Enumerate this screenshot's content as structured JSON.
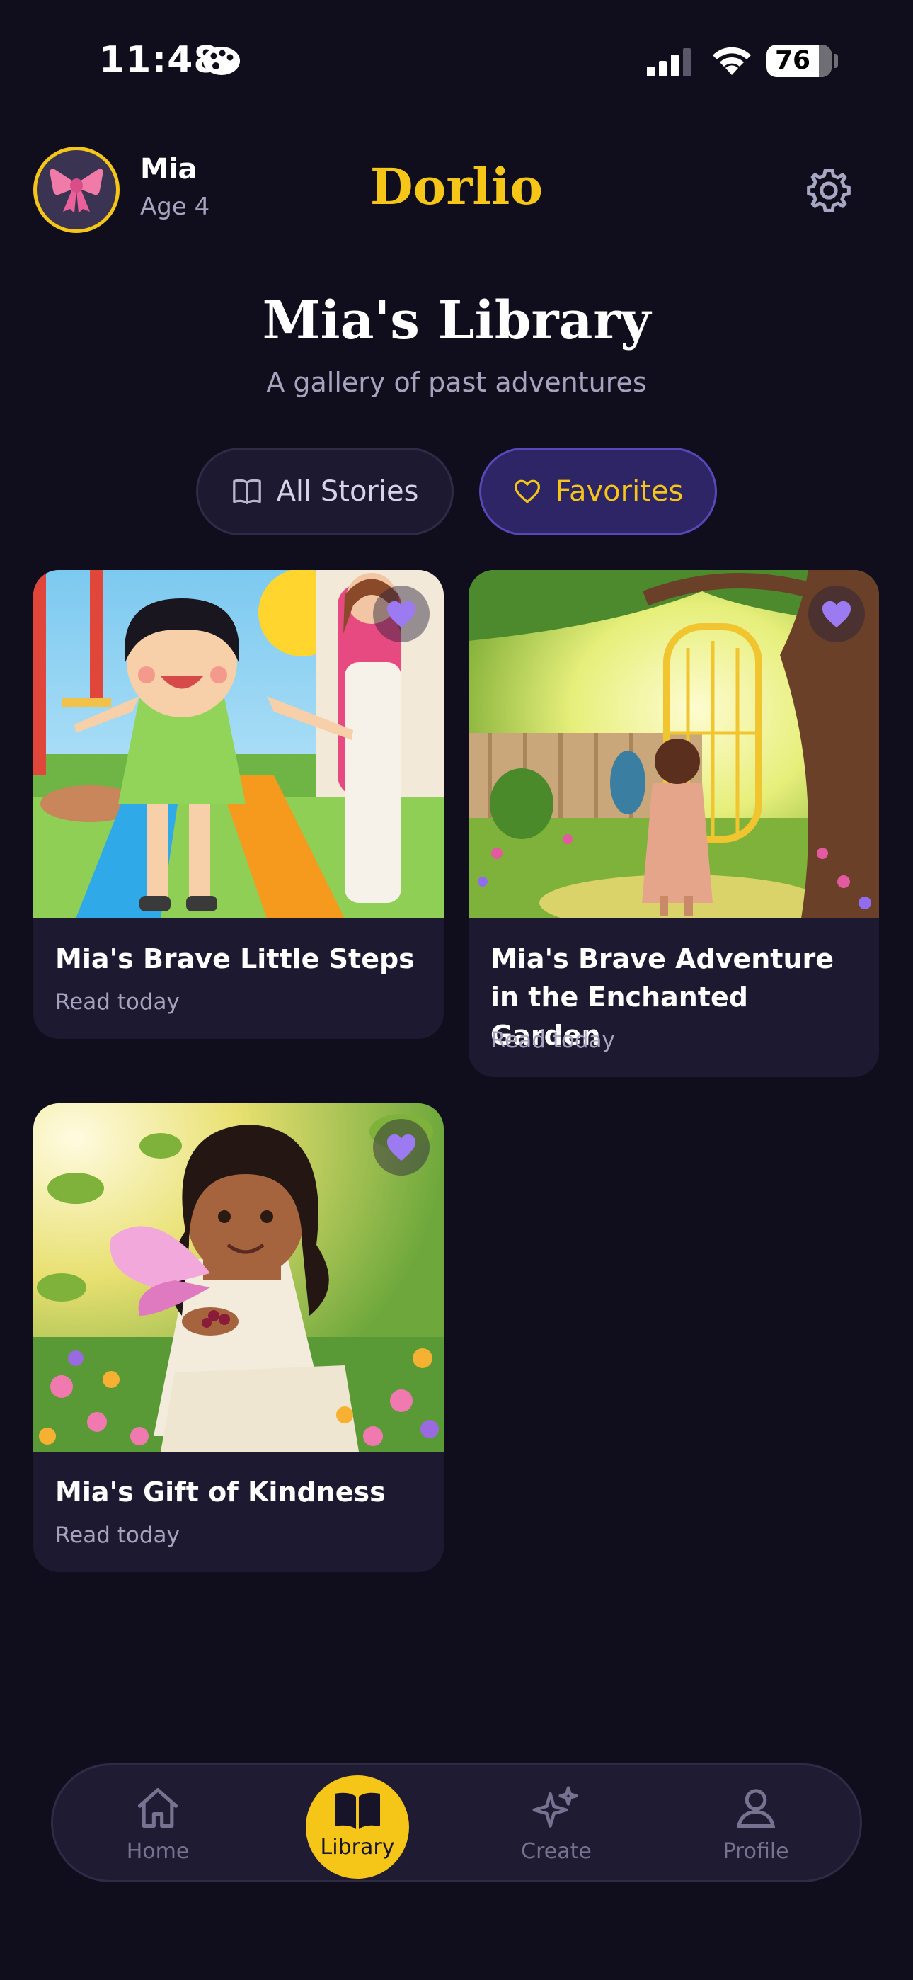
{
  "status_bar": {
    "time": "11:48",
    "battery": "76"
  },
  "header": {
    "user_name": "Mia",
    "user_age": "Age 4",
    "app_name": "Dorlio",
    "avatar_icon": "ribbon-bow-icon",
    "settings_icon": "gear-icon"
  },
  "library": {
    "title": "Mia's Library",
    "subtitle": "A gallery of past adventures"
  },
  "filters": [
    {
      "label": "All Stories",
      "icon": "book-icon",
      "active": false
    },
    {
      "label": "Favorites",
      "icon": "heart-icon",
      "active": true
    }
  ],
  "stories": [
    {
      "title": "Mia's Brave Little Steps",
      "meta": "Read today",
      "favorite": true
    },
    {
      "title": "Mia's Brave Adventure in the Enchanted Garden",
      "meta": "Read today",
      "favorite": true
    },
    {
      "title": "Mia's Gift of Kindness",
      "meta": "Read today",
      "favorite": true
    }
  ],
  "nav": [
    {
      "label": "Home",
      "icon": "home-icon",
      "active": false
    },
    {
      "label": "Library",
      "icon": "open-book-icon",
      "active": true
    },
    {
      "label": "Create",
      "icon": "sparkles-icon",
      "active": false
    },
    {
      "label": "Profile",
      "icon": "person-icon",
      "active": false
    }
  ],
  "colors": {
    "background": "#100e1c",
    "accent_yellow": "#f5c518",
    "accent_purple": "#8f6cf0",
    "card": "#1c1930"
  }
}
